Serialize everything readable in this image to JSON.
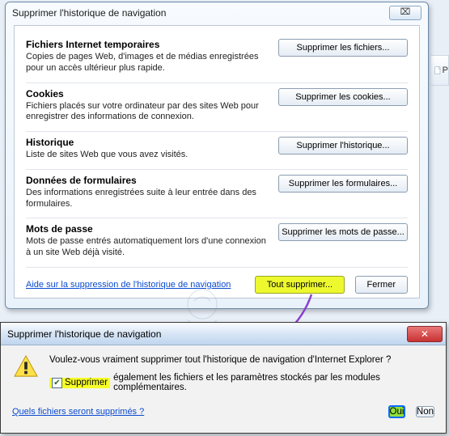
{
  "dialog1": {
    "title": "Supprimer l'historique de navigation",
    "close_glyph": "⌧",
    "sections": {
      "temp": {
        "title": "Fichiers Internet temporaires",
        "desc": "Copies de pages Web, d'images et de médias enregistrées pour un accès ultérieur plus rapide.",
        "button": "Supprimer les fichiers..."
      },
      "cook": {
        "title": "Cookies",
        "desc": "Fichiers placés sur votre ordinateur par des sites Web pour enregistrer des informations de connexion.",
        "button": "Supprimer les cookies..."
      },
      "hist": {
        "title": "Historique",
        "desc": "Liste de sites Web que vous avez visités.",
        "button": "Supprimer l'historique..."
      },
      "form": {
        "title": "Données de formulaires",
        "desc": "Des informations enregistrées suite à leur entrée dans des formulaires.",
        "button": "Supprimer les formulaires..."
      },
      "pass": {
        "title": "Mots de passe",
        "desc": "Mots de passe entrés automatiquement lors d'une connexion à un site Web déjà visité.",
        "button": "Supprimer les mots de passe..."
      }
    },
    "help_link": "Aide sur la suppression de l'historique de navigation ",
    "delete_all": "Tout supprimer...",
    "close": "Fermer"
  },
  "side": {
    "label": "P"
  },
  "dialog2": {
    "title": "Supprimer l'historique de navigation",
    "close_glyph": "✕",
    "question": "Voulez-vous vraiment supprimer tout l'historique de navigation d'Internet Explorer ?",
    "checkbox_checkmark": "✔",
    "checkbox_label": "Supprimer",
    "checkbox_tail": " également les fichiers et les paramètres stockés par les modules complémentaires.",
    "help_link": "Quels fichiers seront supprimés ?",
    "yes": "Oui",
    "no": "Non"
  }
}
